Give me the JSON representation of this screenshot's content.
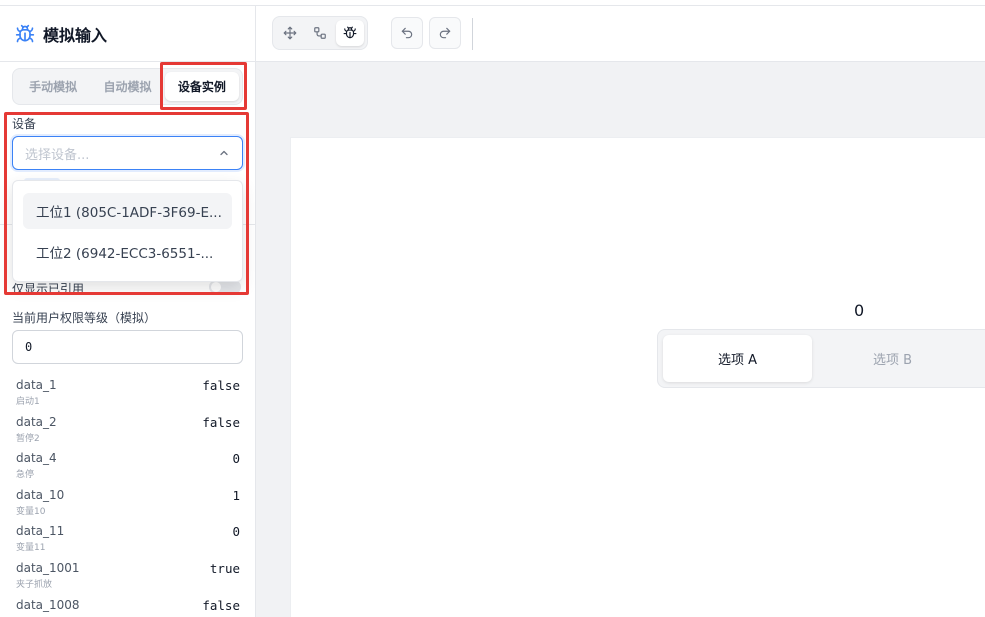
{
  "sidebar": {
    "title": "模拟输入",
    "tabs": [
      {
        "label": "手动模拟",
        "active": false
      },
      {
        "label": "自动模拟",
        "active": false
      },
      {
        "label": "设备实例",
        "active": true
      }
    ],
    "device_label": "设备",
    "device_placeholder": "选择设备...",
    "device_options": [
      "工位1 (805C-1ADF-3F69-E...",
      "工位2 (6942-ECC3-6551-..."
    ],
    "only_referenced_label": "仅显示已引用",
    "permission_label": "当前用户权限等级（模拟）",
    "permission_value": "0",
    "variables": [
      {
        "name": "data_1",
        "desc": "启动1",
        "value": "false"
      },
      {
        "name": "data_2",
        "desc": "暂停2",
        "value": "false"
      },
      {
        "name": "data_4",
        "desc": "急停",
        "value": "0"
      },
      {
        "name": "data_10",
        "desc": "变量10",
        "value": "1"
      },
      {
        "name": "data_11",
        "desc": "变量11",
        "value": "0"
      },
      {
        "name": "data_1001",
        "desc": "夹子抓放",
        "value": "true"
      },
      {
        "name": "data_1008",
        "desc": "",
        "value": "false"
      }
    ]
  },
  "toolbar": {
    "icons": [
      "move-icon",
      "nodes-icon",
      "bug-icon",
      "undo-icon",
      "redo-icon"
    ],
    "active_tool": "bug-icon"
  },
  "canvas": {
    "value_text": "0",
    "segment_options": [
      {
        "label": "选项 A",
        "active": true
      },
      {
        "label": "选项 B",
        "active": false
      }
    ]
  },
  "colors": {
    "accent": "#3b82f6",
    "highlight": "#e53935"
  }
}
